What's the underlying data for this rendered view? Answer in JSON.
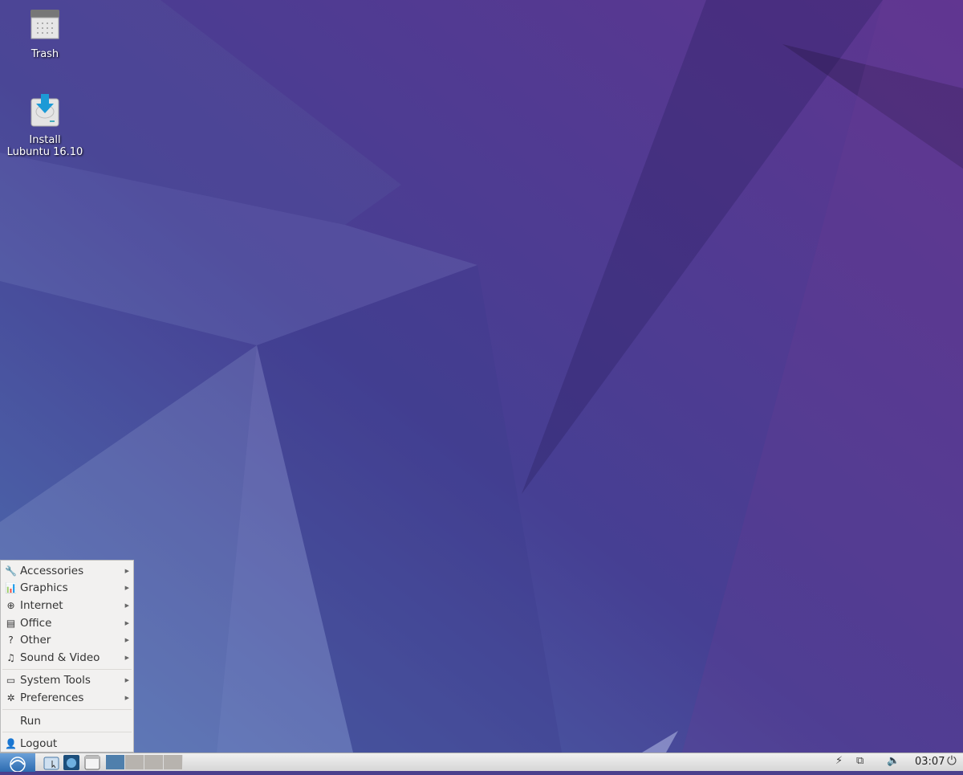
{
  "desktop": {
    "icons": [
      {
        "label": "Trash",
        "icon": "trash-icon"
      },
      {
        "label": "Install\nLubuntu 16.10",
        "icon": "install-icon"
      }
    ]
  },
  "menu": {
    "items": [
      {
        "label": "Accessories",
        "icon": "accessories-icon",
        "submenu": true
      },
      {
        "label": "Graphics",
        "icon": "graphics-icon",
        "submenu": true
      },
      {
        "label": "Internet",
        "icon": "globe-icon",
        "submenu": true
      },
      {
        "label": "Office",
        "icon": "document-icon",
        "submenu": true
      },
      {
        "label": "Other",
        "icon": "question-icon",
        "submenu": true
      },
      {
        "label": "Sound & Video",
        "icon": "multimedia-icon",
        "submenu": true
      },
      {
        "label": "System Tools",
        "icon": "monitor-icon",
        "submenu": true
      },
      {
        "label": "Preferences",
        "icon": "gear-icon",
        "submenu": true
      },
      {
        "label": "Run",
        "icon": "",
        "submenu": false
      },
      {
        "label": "Logout",
        "icon": "logout-icon",
        "submenu": false
      }
    ]
  },
  "taskbar": {
    "clock": "03:07",
    "workspaces": 4,
    "active_workspace": 1,
    "accent": "#4f7fac"
  }
}
